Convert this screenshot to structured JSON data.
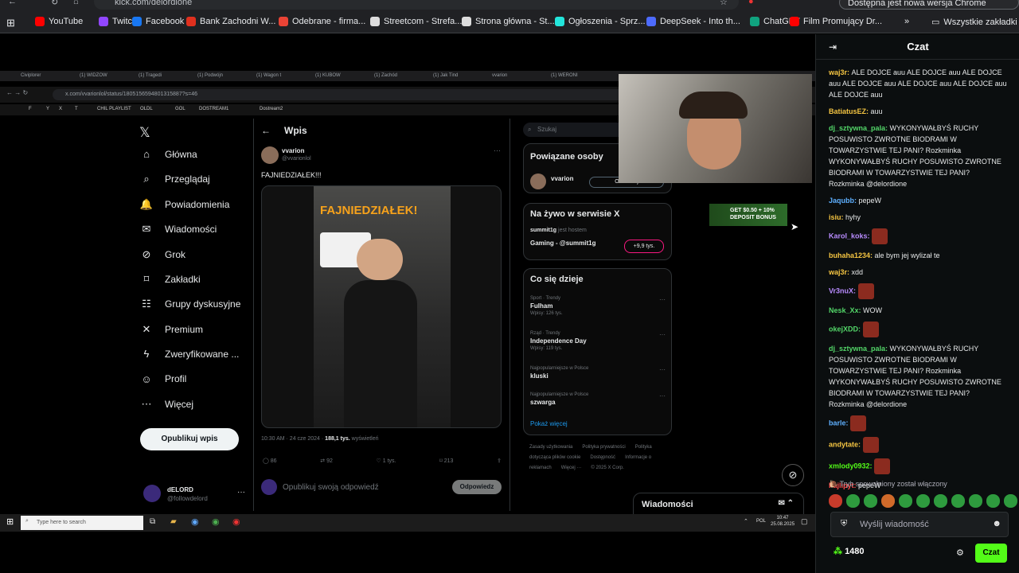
{
  "browser": {
    "url": "kick.com/delordione",
    "update_label": "Dostępna jest nowa wersja Chrome",
    "bookmarks": [
      {
        "label": "YouTube",
        "color": "#ff0000"
      },
      {
        "label": "Twitch",
        "color": "#9146ff"
      },
      {
        "label": "Facebook",
        "color": "#1877f2"
      },
      {
        "label": "Bank Zachodni W...",
        "color": "#e0301e"
      },
      {
        "label": "Odebrane - firma...",
        "color": "#ea4335"
      },
      {
        "label": "Streetcom - Strefa...",
        "color": "#dddddd"
      },
      {
        "label": "Strona główna - St...",
        "color": "#dddddd"
      },
      {
        "label": "Ogłoszenia - Sprz...",
        "color": "#23e5db"
      },
      {
        "label": "DeepSeek - Into th...",
        "color": "#4d6bfe"
      },
      {
        "label": "ChatGPT",
        "color": "#10a37f"
      },
      {
        "label": "Film Promujący Dr...",
        "color": "#ff0000"
      }
    ],
    "all_bookmarks": "Wszystkie zakładki"
  },
  "stream": {
    "inner_tabs": [
      "Civiplorer",
      "(1) WIDZOW",
      "(1) Tragedi",
      "(1) Podwójn",
      "(1) Wagon t",
      "(1) KUBOW",
      "(1) Zachód",
      "(1) Jak Tind",
      "vvarion",
      "(1) WERONI"
    ],
    "inner_url": "x.com/vvarionlol/status/1805156594801315887?s=46",
    "inner_bookmarks": [
      "F",
      "Y",
      "X",
      "T",
      "CHIL PLAYLIST",
      "OLDL",
      "GOL",
      "DOSTREAM1",
      "Dostream2"
    ],
    "x_nav": [
      {
        "label": "Główna",
        "icon": "home-icon"
      },
      {
        "label": "Przeglądaj",
        "icon": "search-icon"
      },
      {
        "label": "Powiadomienia",
        "icon": "bell-icon"
      },
      {
        "label": "Wiadomości",
        "icon": "mail-icon"
      },
      {
        "label": "Grok",
        "icon": "grok-icon"
      },
      {
        "label": "Zakładki",
        "icon": "bookmark-icon"
      },
      {
        "label": "Grupy dyskusyjne",
        "icon": "people-icon"
      },
      {
        "label": "Premium",
        "icon": "x-icon"
      },
      {
        "label": "Zweryfikowane ...",
        "icon": "bolt-icon"
      },
      {
        "label": "Profil",
        "icon": "person-icon"
      },
      {
        "label": "Więcej",
        "icon": "more-icon"
      }
    ],
    "post_button": "Opublikuj wpis",
    "account": {
      "name": "dELORD",
      "handle": "@followdelord"
    },
    "post": {
      "header": "Wpis",
      "author": "vvarion",
      "handle": "@vvarionlol",
      "text": "FAJNIEDZIAŁEK!!!",
      "video_caption": "FAJNIEDZIAŁEK!",
      "timestamp": "10:30 AM · 24 cze 2024 · ",
      "views": "188,1 tys.",
      "views_label": "wyświetleń",
      "stats": {
        "replies": "86",
        "reposts": "92",
        "likes": "1 tys.",
        "bookmarks": "213"
      },
      "reply_placeholder": "Opublikuj swoją odpowiedź",
      "reply_button": "Odpowiedz"
    },
    "right": {
      "search": "Szukaj",
      "related_title": "Powiązane osoby",
      "related_name": "vvarion",
      "related_btn": "Obserwuj",
      "live_title": "Na żywo w serwisie X",
      "live_host": "summit1g",
      "live_host_label": "jest hostem",
      "live_name": "Gaming - @summit1g",
      "live_count": "+9,9 tys.",
      "trending_title": "Co się dzieje",
      "trends": [
        {
          "cat": "Sport · Trendy",
          "name": "Fulham",
          "count": "Wpisy: 126 tys."
        },
        {
          "cat": "Rząd · Trendy",
          "name": "Independence Day",
          "count": "Wpisy: 119 tys."
        },
        {
          "cat": "Najpopularniejsze w Polsce",
          "name": "kluski",
          "count": ""
        },
        {
          "cat": "Najpopularniejsze w Polsce",
          "name": "szwarga",
          "count": ""
        }
      ],
      "show_more": "Pokaż więcej",
      "footer": [
        "Zasady użytkowania",
        "Polityka prywatności",
        "Polityka dotycząca plików cookie",
        "Dostępność",
        "Informacje o reklamach",
        "Więcej ···",
        "© 2025 X Corp."
      ],
      "messages_label": "Wiadomości"
    },
    "ad": "GET $0.50 + 10% DEPOSIT BONUS",
    "taskbar": {
      "search": "Type here to search",
      "lang": "POL",
      "time": "10:47",
      "date": "25.08.2025"
    }
  },
  "chat": {
    "title": "Czat",
    "messages": [
      {
        "user": "waj3r",
        "color": "#f5c542",
        "text": "ALE DOJCE auu ALE DOJCE auu ALE DOJCE auu ALE DOJCE auu ALE DOJCE auu ALE DOJCE auu ALE DOJCE auu",
        "emote": false
      },
      {
        "user": "BatiatusEZ",
        "color": "#f5c542",
        "text": "auu",
        "emote": false
      },
      {
        "user": "dj_sztywna_pala",
        "color": "#53d769",
        "text": "WYKONYWAŁBYŚ RUCHY POSUWISTO ZWROTNE BIODRAMI W TOWARZYSTWIE TEJ PANI? Rozkminka WYKONYWAŁBYŚ RUCHY POSUWISTO ZWROTNE BIODRAMI W TOWARZYSTWIE TEJ PANI? Rozkminka @delordione",
        "emote": false
      },
      {
        "user": "Jaqubb",
        "color": "#5eb0ff",
        "text": "pepeW",
        "emote": false
      },
      {
        "user": "isiu",
        "color": "#f5c542",
        "text": "hyhy",
        "emote": false
      },
      {
        "user": "Karol_koks",
        "color": "#b98cff",
        "text": "",
        "emote": true
      },
      {
        "user": "buhaha1234",
        "color": "#f5c542",
        "text": "ale bym jej wylizał te",
        "emote": false
      },
      {
        "user": "waj3r",
        "color": "#f5c542",
        "text": "xdd",
        "emote": false
      },
      {
        "user": "Vr3nuX",
        "color": "#b98cff",
        "text": "",
        "emote": true
      },
      {
        "user": "Nesk_Xx",
        "color": "#53d769",
        "text": "WOW",
        "emote": false
      },
      {
        "user": "okejXDD",
        "color": "#53d769",
        "text": "",
        "emote": true
      },
      {
        "user": "dj_sztywna_pala",
        "color": "#53d769",
        "text": "WYKONYWAŁBYŚ RUCHY POSUWISTO ZWROTNE BIODRAMI W TOWARZYSTWIE TEJ PANI? Rozkminka WYKONYWAŁBYŚ RUCHY POSUWISTO ZWROTNE BIODRAMI W TOWARZYSTWIE TEJ PANI? Rozkminka @delordione",
        "emote": false
      },
      {
        "user": "barle",
        "color": "#5eb0ff",
        "text": "",
        "emote": true
      },
      {
        "user": "andytate",
        "color": "#f5c542",
        "text": "",
        "emote": true
      },
      {
        "user": "xmlody0932",
        "color": "#53fc18",
        "text": "",
        "emote": true
      },
      {
        "user": "Fajlipyt",
        "color": "#ff4b4b",
        "text": "pepeW",
        "emote": false
      }
    ],
    "slow_mode": "Tryb spowolniony został włączony",
    "input_placeholder": "Wyślij wiadomość",
    "points": "1480",
    "send_button": "Czat"
  }
}
